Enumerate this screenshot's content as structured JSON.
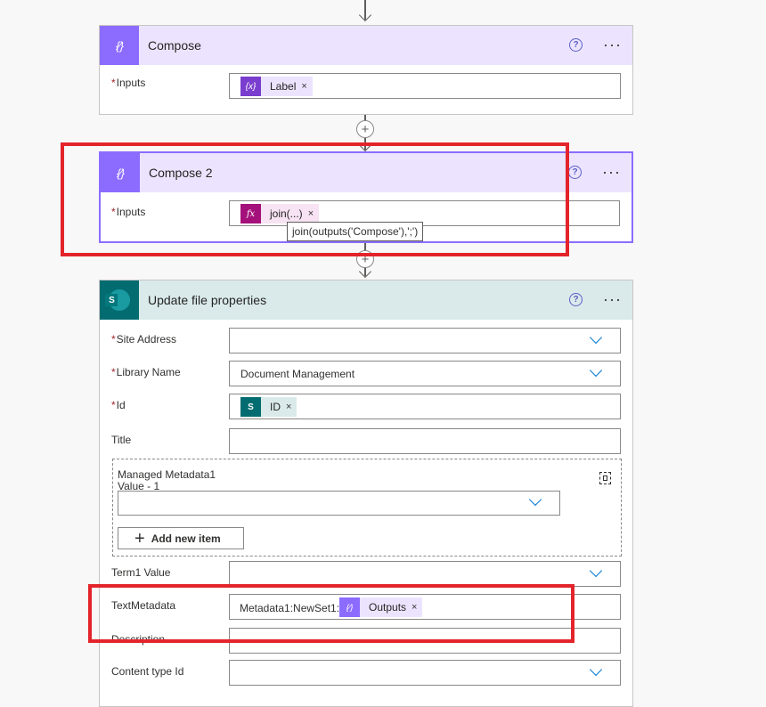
{
  "compose": {
    "title": "Compose",
    "inputs_label": "Inputs",
    "token": "Label",
    "token_icon": "{x}"
  },
  "compose2": {
    "title": "Compose 2",
    "inputs_label": "Inputs",
    "token": "join(...)",
    "token_icon": "fx",
    "tooltip": "join(outputs('Compose'),';')"
  },
  "update": {
    "title": "Update file properties",
    "site_address_label": "Site Address",
    "site_address_value": "",
    "library_label": "Library Name",
    "library_value": "Document Management",
    "id_label": "Id",
    "id_token": "ID",
    "title_label": "Title",
    "managed_metadata_label": "Managed Metadata1 Value - 1",
    "add_item_label": "Add new item",
    "term1_label": "Term1 Value",
    "textmetadata_label": "TextMetadata",
    "textmetadata_prefix": "Metadata1:NewSet1:",
    "textmetadata_token": "Outputs",
    "description_label": "Description",
    "content_type_label": "Content type Id"
  },
  "common": {
    "help_glyph": "?",
    "more_glyph": "···",
    "remove_glyph": "×",
    "plus_glyph": "+"
  }
}
